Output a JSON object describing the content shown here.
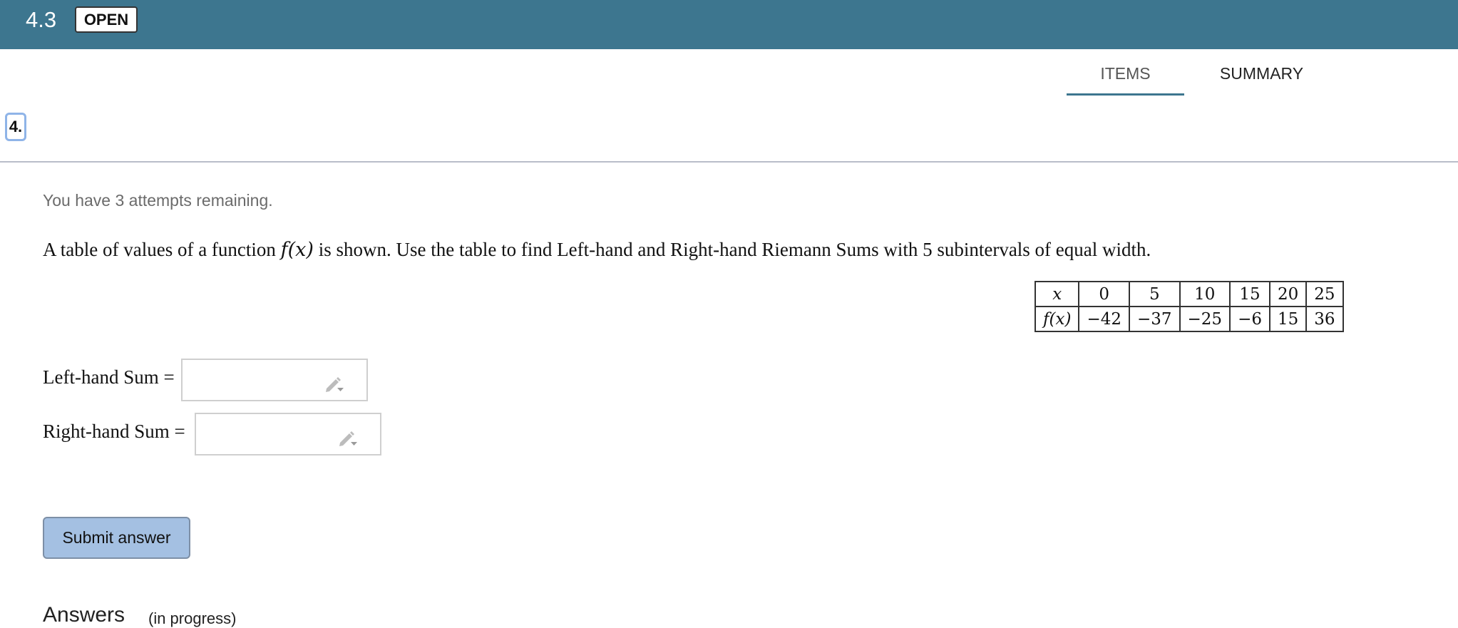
{
  "header": {
    "section_number": "4.3",
    "status_badge": "OPEN"
  },
  "tabs": [
    {
      "label": "ITEMS",
      "active": true
    },
    {
      "label": "SUMMARY",
      "active": false
    }
  ],
  "question": {
    "number": "4.",
    "attempts_text": "You have 3 attempts remaining.",
    "text_before": "A table of values of a function ",
    "function_notation": "f(x)",
    "text_after": " is shown. Use the table to find Left-hand and Right-hand Riemann Sums with 5 subintervals of equal width."
  },
  "table": {
    "x_label": "x",
    "fx_label": "f(x)",
    "x_values": [
      "0",
      "5",
      "10",
      "15",
      "20",
      "25"
    ],
    "fx_values": [
      "−42",
      "−37",
      "−25",
      "−6",
      "15",
      "36"
    ]
  },
  "answers": {
    "left_label": "Left-hand Sum =",
    "left_value": "",
    "right_label": "Right-hand Sum =",
    "right_value": ""
  },
  "submit_label": "Submit answer",
  "answers_section": {
    "heading": "Answers",
    "status": "(in progress)"
  }
}
